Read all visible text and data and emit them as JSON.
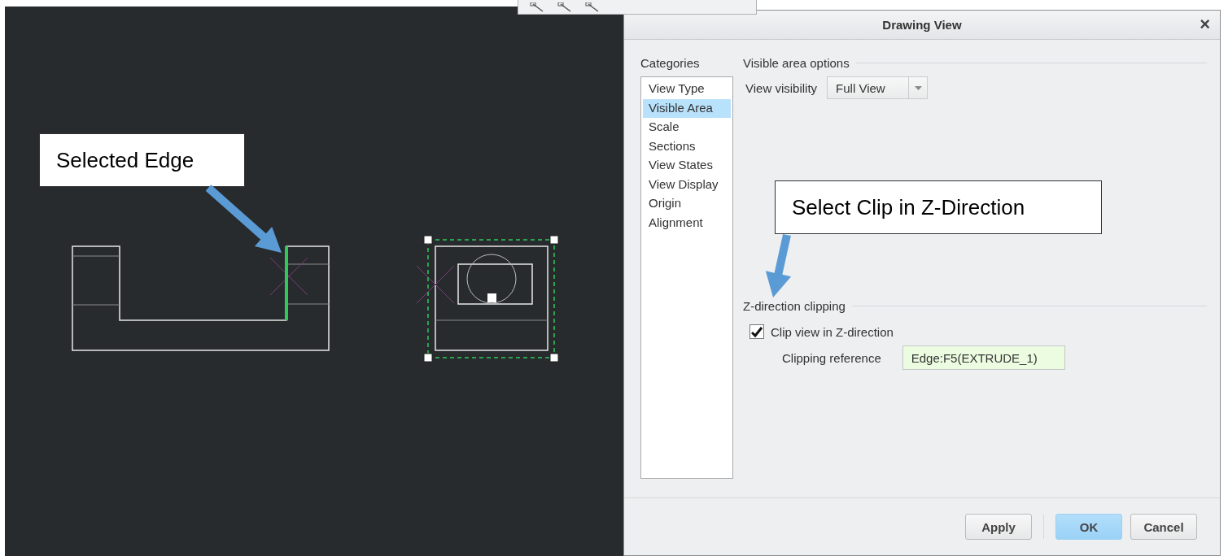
{
  "dialog": {
    "title": "Drawing View",
    "close": "×"
  },
  "categories": {
    "label": "Categories",
    "items": [
      {
        "label": "View Type",
        "selected": false
      },
      {
        "label": "Visible Area",
        "selected": true
      },
      {
        "label": "Scale",
        "selected": false
      },
      {
        "label": "Sections",
        "selected": false
      },
      {
        "label": "View States",
        "selected": false
      },
      {
        "label": "View Display",
        "selected": false
      },
      {
        "label": "Origin",
        "selected": false
      },
      {
        "label": "Alignment",
        "selected": false
      }
    ]
  },
  "visible_area": {
    "heading": "Visible area options",
    "visibility_label": "View visibility",
    "visibility_value": "Full View"
  },
  "z_clipping": {
    "heading": "Z-direction clipping",
    "checkbox": {
      "label": "Clip view in Z-direction",
      "checked": true
    },
    "reference_label": "Clipping reference",
    "reference_value": "Edge:F5(EXTRUDE_1)"
  },
  "buttons": [
    {
      "label": "Apply",
      "kind": "secondary"
    },
    {
      "label": "OK",
      "kind": "primary"
    },
    {
      "label": "Cancel",
      "kind": "secondary"
    }
  ],
  "annotations": [
    {
      "text": "Selected Edge"
    },
    {
      "text": "Select Clip in Z-Direction"
    }
  ]
}
